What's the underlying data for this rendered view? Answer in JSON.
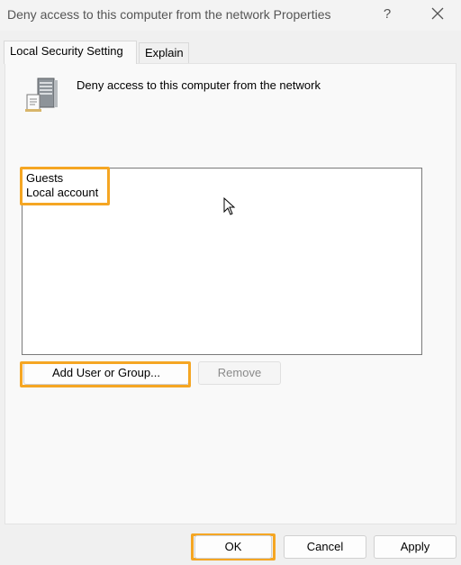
{
  "window": {
    "title": "Deny access to this computer from the network Properties",
    "help_label": "?"
  },
  "tabs": [
    {
      "label": "Local Security Setting",
      "active": true
    },
    {
      "label": "Explain",
      "active": false
    }
  ],
  "policy": {
    "icon": "server-policy-icon",
    "name": "Deny access to this computer from the network"
  },
  "accounts": {
    "items": [
      "Guests",
      "Local account"
    ]
  },
  "actions": {
    "add_label": "Add User or Group...",
    "remove_label": "Remove",
    "remove_enabled": false
  },
  "footer": {
    "ok_label": "OK",
    "cancel_label": "Cancel",
    "apply_label": "Apply"
  },
  "colors": {
    "highlight": "#f5a623"
  }
}
